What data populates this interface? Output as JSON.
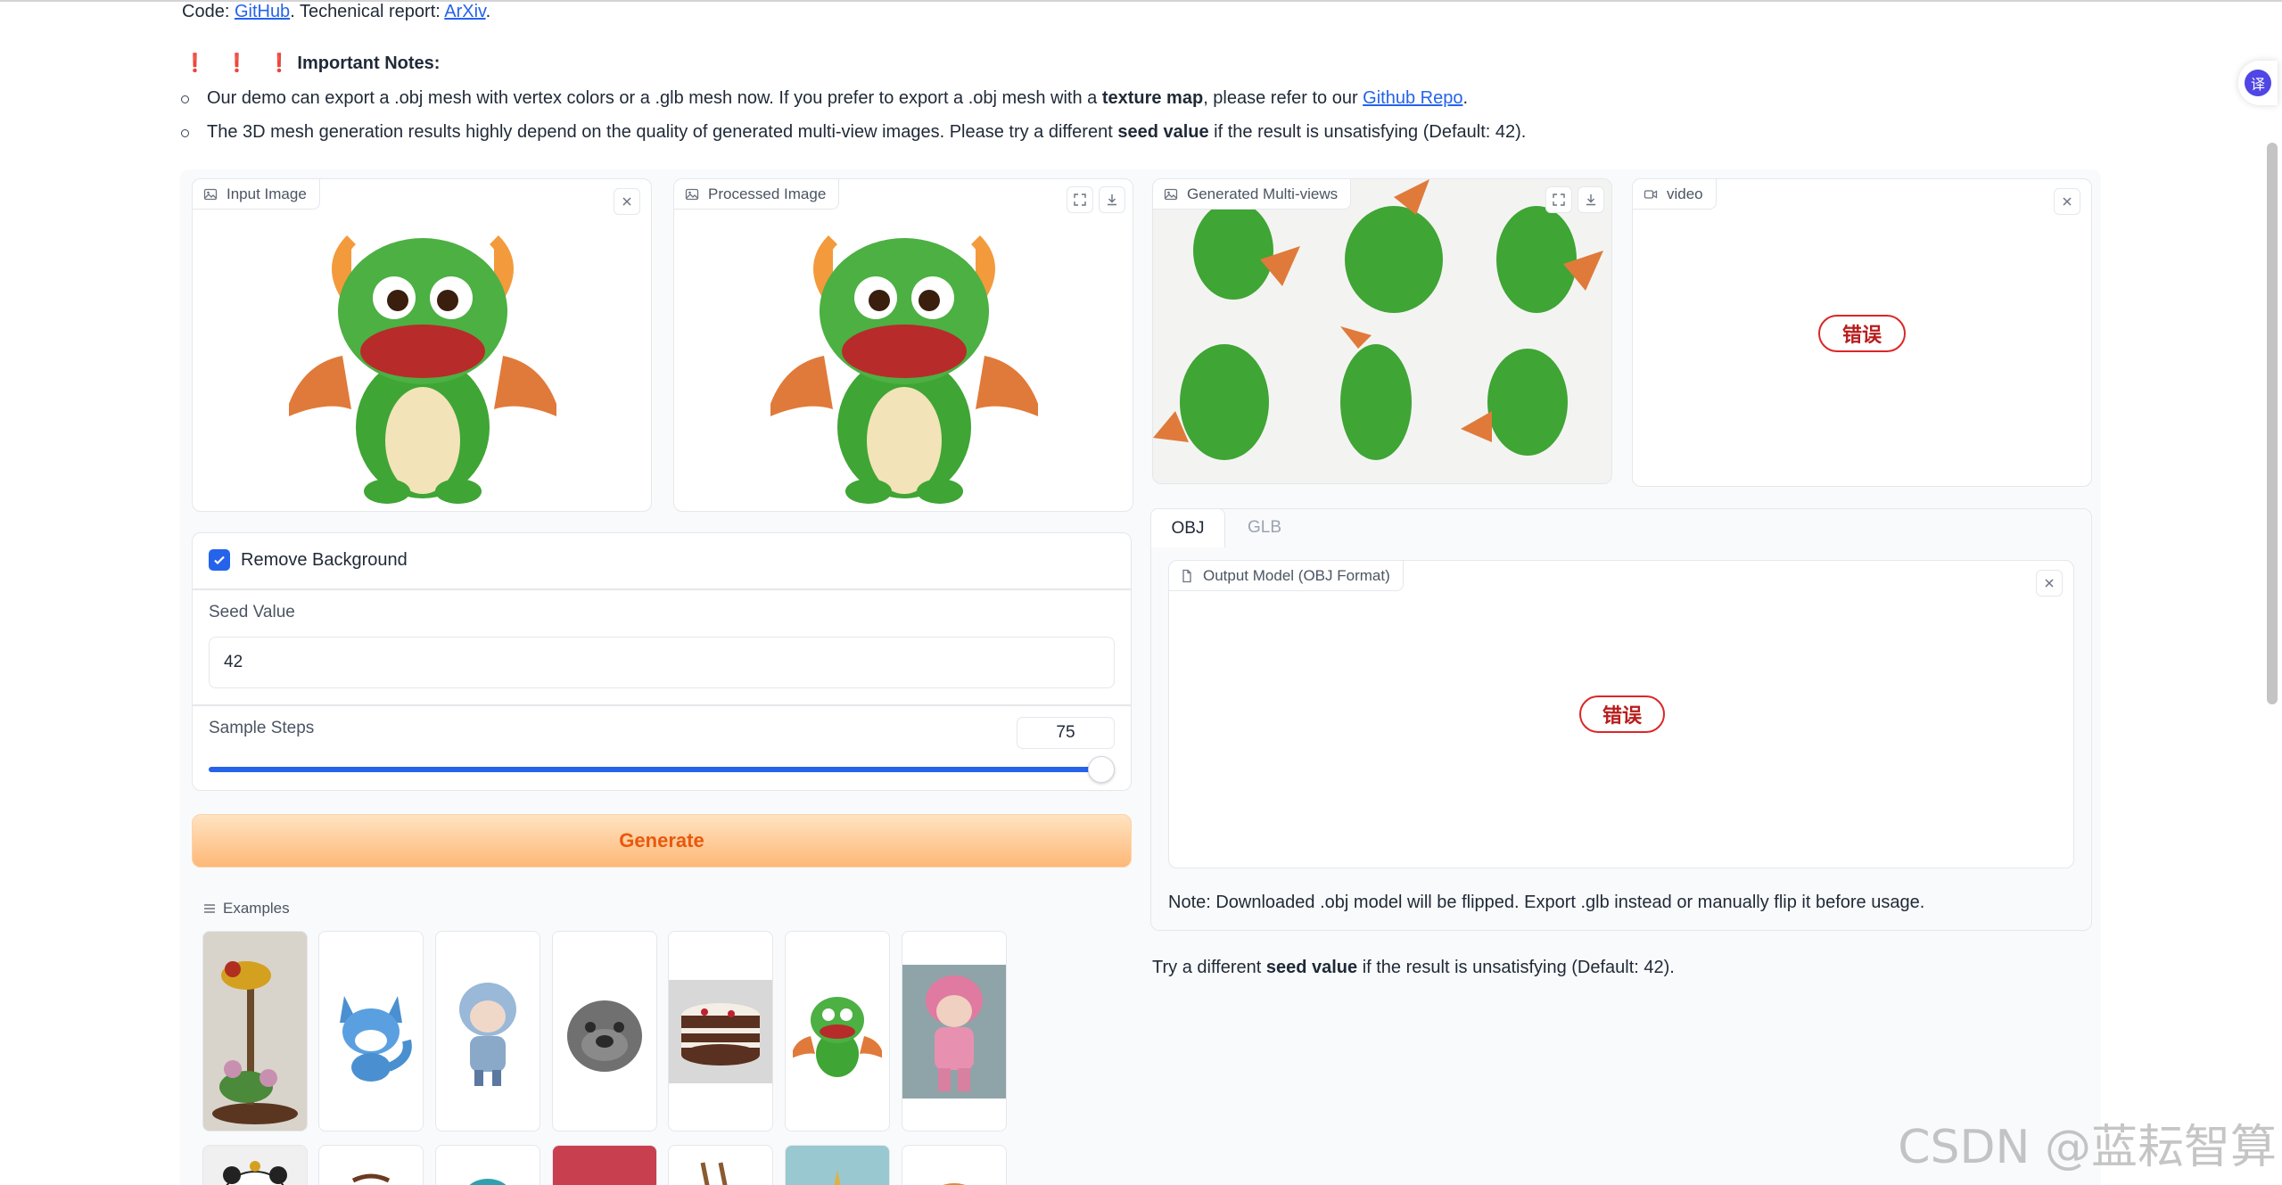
{
  "header": {
    "code_prefix": "Code: ",
    "github_link": "GitHub",
    "report_text": ". Techenical report: ",
    "arxiv_link": "ArXiv",
    "period": ".",
    "notes_marks": "❗ ❗ ❗",
    "notes_title": "Important Notes:",
    "bullet1_a": "Our demo can export a .obj mesh with vertex colors or a .glb mesh now. If you prefer to export a .obj mesh with a ",
    "bullet1_bold": "texture map",
    "bullet1_b": ", please refer to our ",
    "bullet1_link": "Github Repo",
    "bullet1_c": ".",
    "bullet2_a": "The 3D mesh generation results highly depend on the quality of generated multi-view images. Please try a different ",
    "bullet2_bold": "seed value",
    "bullet2_b": " if the result is unsatisfying (Default: 42)."
  },
  "input_image": {
    "label": "Input Image"
  },
  "processed_image": {
    "label": "Processed Image"
  },
  "multiviews": {
    "label": "Generated Multi-views"
  },
  "video": {
    "label": "video",
    "error": "错误"
  },
  "controls": {
    "remove_bg_label": "Remove Background",
    "remove_bg_checked": true,
    "seed_label": "Seed Value",
    "seed_value": "42",
    "steps_label": "Sample Steps",
    "steps_value": "75",
    "steps_fraction": 0.985
  },
  "generate_button": "Generate",
  "examples": {
    "label": "Examples"
  },
  "tabs": [
    {
      "label": "OBJ",
      "active": true
    },
    {
      "label": "GLB",
      "active": false
    }
  ],
  "output_model": {
    "label": "Output Model (OBJ Format)",
    "error": "错误"
  },
  "note": "Note: Downloaded .obj model will be flipped. Export .glb instead or manually flip it before usage.",
  "seed_tip": {
    "a": "Try a different ",
    "bold": "seed value",
    "b": " if the result is unsatisfying (Default: 42)."
  },
  "translate_badge": "译",
  "watermark": "CSDN @蓝耘智算",
  "colors": {
    "accent": "#2563eb",
    "error": "#dc2626",
    "generate": "#ea580c"
  }
}
